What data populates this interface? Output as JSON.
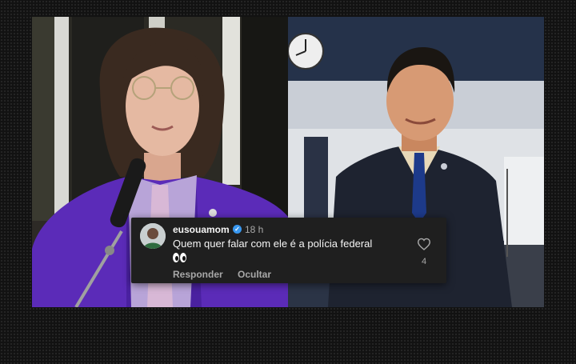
{
  "comment": {
    "username": "eusouamom",
    "verified": true,
    "time": "18 h",
    "text": "Quem quer falar com ele é a polícia federal",
    "emoji": "👀",
    "reply_label": "Responder",
    "hide_label": "Ocultar",
    "like_count": "4"
  },
  "icons": {
    "verified": "verified-badge-icon",
    "like": "heart-icon",
    "emoji": "eyes-emoji"
  },
  "colors": {
    "verified_badge": "#3897f0",
    "card_background": "#1f1f1f",
    "suit_purple": "#5b2bb8"
  }
}
